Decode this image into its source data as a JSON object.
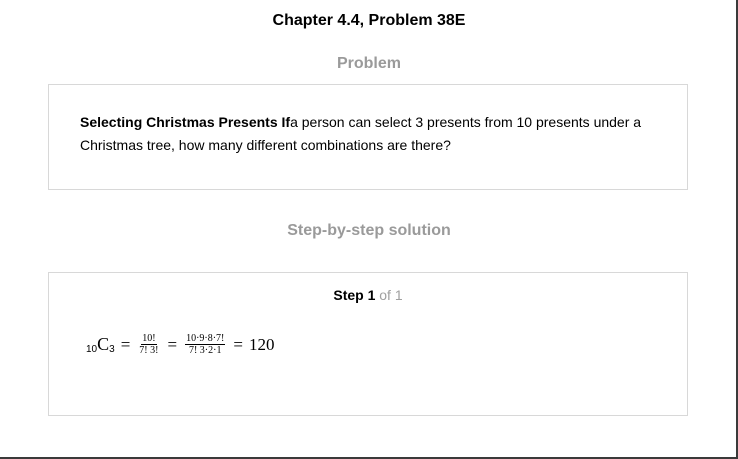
{
  "header": {
    "chapter_title": "Chapter 4.4, Problem 38E"
  },
  "problem": {
    "heading": "Problem",
    "bold_lead": "Selecting Christmas Presents If",
    "text": "a person can select 3 presents from 10 presents under a Christmas tree, how many different combinations are there?"
  },
  "solution": {
    "heading": "Step-by-step solution",
    "step": {
      "word": "Step 1",
      "of": " of 1"
    },
    "math": {
      "pre_sub": "10",
      "symbol": "C",
      "post_sub": "3",
      "eq1": "=",
      "frac1_num": "10!",
      "frac1_den": "7! 3!",
      "eq2": "=",
      "frac2_num": "10·9·8·7!",
      "frac2_den": "7! 3·2·1",
      "eq3": "=",
      "result": "120"
    }
  }
}
